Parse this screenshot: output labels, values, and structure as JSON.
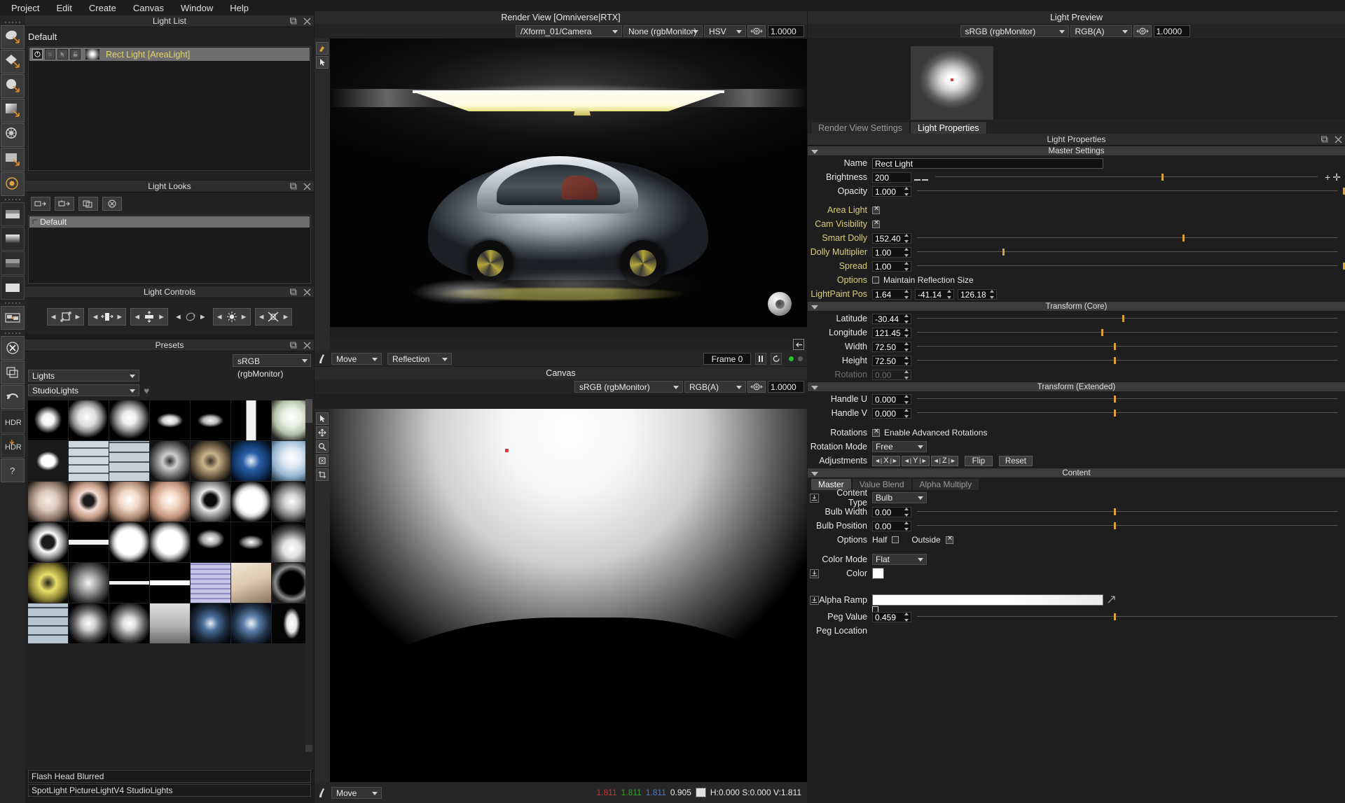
{
  "menubar": {
    "items": [
      "Project",
      "Edit",
      "Create",
      "Canvas",
      "Window",
      "Help"
    ]
  },
  "light_list": {
    "title": "Light List",
    "default_label": "Default",
    "rows": [
      {
        "name": "Rect Light [AreaLight]",
        "toggles": [
          "power-icon",
          "solo-icon",
          "select-icon",
          "lock-icon"
        ]
      }
    ]
  },
  "light_looks": {
    "title": "Light Looks",
    "tools": [
      "add-look-icon",
      "add-group-icon",
      "duplicate-icon",
      "delete-icon"
    ],
    "rows": [
      "Default"
    ]
  },
  "light_controls": {
    "title": "Light Controls",
    "buttons": [
      "scale-uniform-icon",
      "scale-width-icon",
      "scale-height-icon",
      "rotate-icon",
      "brightness-icon",
      "spread-icon"
    ]
  },
  "presets": {
    "title": "Presets",
    "colorspace": "sRGB (rgbMonitor)",
    "category": "Lights",
    "subcategory": "StudioLights",
    "favorite_icon": "heart-icon",
    "selected_name": "Flash Head Blurred",
    "path_name": "SpotLight PictureLightV4 StudioLights"
  },
  "render_view": {
    "title": "Render View [Omniverse|RTX]",
    "camera": "/Xform_01/Camera",
    "aov": "None (rgbMonitor)",
    "colorspace": "HSV",
    "exposure": "1.0000",
    "mode": "Move",
    "channel": "Reflection",
    "frame": "Frame 0",
    "tools": [
      "paint-icon",
      "select-icon"
    ],
    "transport": [
      "pause-icon",
      "refresh-icon"
    ],
    "status_dots": [
      "green-dot",
      "grey-dot"
    ],
    "collapse_icon": "collapse-left-icon"
  },
  "canvas": {
    "title": "Canvas",
    "colorspace": "sRGB (rgbMonitor)",
    "channel": "RGB(A)",
    "exposure": "1.0000",
    "mode": "Move",
    "tools": [
      "select-icon",
      "pan-icon",
      "zoom-icon",
      "fit-icon",
      "crop-icon"
    ],
    "pixel_r": "1.811",
    "pixel_g": "1.811",
    "pixel_b": "1.811",
    "pixel_a": "0.905",
    "hsv": "H:0.000 S:0.000 V:1.811"
  },
  "light_preview": {
    "title": "Light Preview",
    "colorspace": "sRGB (rgbMonitor)",
    "channel": "RGB(A)",
    "exposure": "1.0000"
  },
  "properties": {
    "tabs": [
      {
        "label": "Render View Settings",
        "active": false
      },
      {
        "label": "Light Properties",
        "active": true
      }
    ],
    "panel_title": "Light Properties",
    "sections": {
      "master": {
        "title": "Master Settings",
        "name_label": "Name",
        "name_value": "Rect Light",
        "brightness_label": "Brightness",
        "brightness_value": "200",
        "opacity_label": "Opacity",
        "opacity_value": "1.000",
        "area_light_label": "Area Light",
        "cam_visibility_label": "Cam Visibility",
        "smart_dolly_label": "Smart Dolly",
        "smart_dolly_value": "152.40",
        "dolly_multiplier_label": "Dolly Multiplier",
        "dolly_multiplier_value": "1.00",
        "spread_label": "Spread",
        "spread_value": "1.00",
        "options_label": "Options",
        "maintain_reflection_label": "Maintain Reflection Size",
        "lightpaint_label": "LightPaint Pos",
        "lightpaint_x": "1.64",
        "lightpaint_y": "-41.14",
        "lightpaint_z": "126.18"
      },
      "transform_core": {
        "title": "Transform (Core)",
        "latitude_label": "Latitude",
        "latitude_value": "-30.44",
        "longitude_label": "Longitude",
        "longitude_value": "121.45",
        "width_label": "Width",
        "width_value": "72.50",
        "height_label": "Height",
        "height_value": "72.50",
        "rotation_label": "Rotation",
        "rotation_value": "0.00"
      },
      "transform_extended": {
        "title": "Transform (Extended)",
        "handle_u_label": "Handle U",
        "handle_u_value": "0.000",
        "handle_v_label": "Handle V",
        "handle_v_value": "0.000",
        "rotations_label": "Rotations",
        "enable_advanced_label": "Enable Advanced Rotations",
        "rotation_mode_label": "Rotation Mode",
        "rotation_mode_value": "Free",
        "adjustments_label": "Adjustments",
        "adjust_x": "X",
        "adjust_y": "Y",
        "adjust_z": "Z",
        "flip_label": "Flip",
        "reset_label": "Reset"
      },
      "content": {
        "title": "Content",
        "tabs": [
          {
            "label": "Master",
            "active": true
          },
          {
            "label": "Value Blend",
            "active": false
          },
          {
            "label": "Alpha Multiply",
            "active": false
          }
        ],
        "content_type_label": "Content Type",
        "content_type_value": "Bulb",
        "bulb_width_label": "Bulb Width",
        "bulb_width_value": "0.00",
        "bulb_position_label": "Bulb Position",
        "bulb_position_value": "0.00",
        "options_label": "Options",
        "half_label": "Half",
        "outside_label": "Outside",
        "color_mode_label": "Color Mode",
        "color_mode_value": "Flat",
        "color_label": "Color",
        "color_value": "#ffffff",
        "alpha_ramp_label": "Alpha Ramp",
        "peg_value_label": "Peg Value",
        "peg_value_value": "0.459",
        "peg_location_label": "Peg Location"
      }
    }
  },
  "colors": {
    "accent_yellow": "#d9cf7c",
    "slider_knob": "#d9a13a",
    "red": "#c83232",
    "green": "#32a032",
    "blue": "#4a7ad0"
  }
}
